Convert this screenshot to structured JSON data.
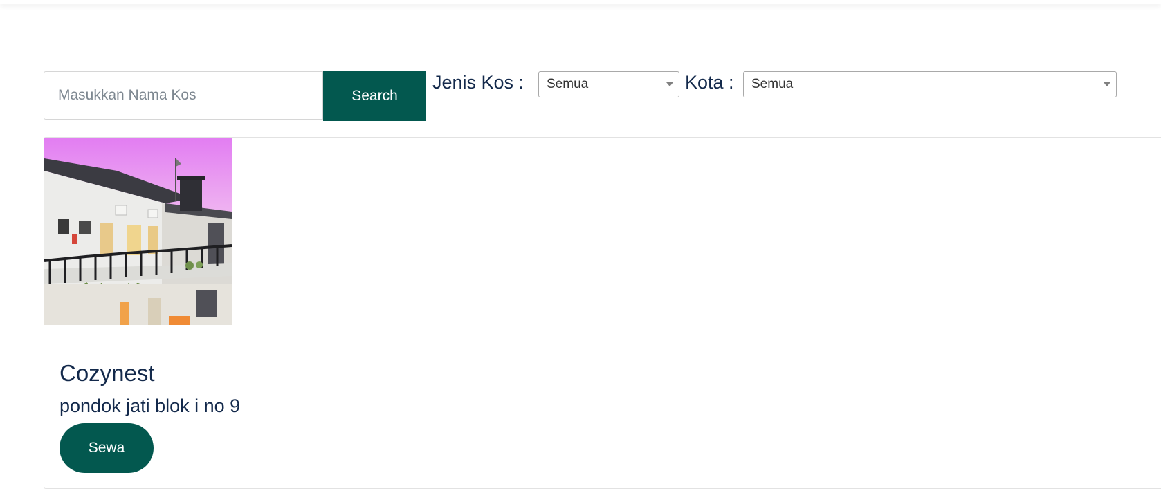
{
  "search": {
    "placeholder": "Masukkan Nama Kos",
    "value": "",
    "button_label": "Search"
  },
  "filters": {
    "jenis": {
      "label": "Jenis Kos :",
      "selected": "Semua"
    },
    "kota": {
      "label": "Kota :",
      "selected": "Semua"
    }
  },
  "listing": {
    "name": "Cozynest",
    "address": "pondok jati blok i no 9",
    "button_label": "Sewa",
    "photo_icon": "building-photo"
  },
  "colors": {
    "accent": "#03584f",
    "text": "#13294b"
  }
}
